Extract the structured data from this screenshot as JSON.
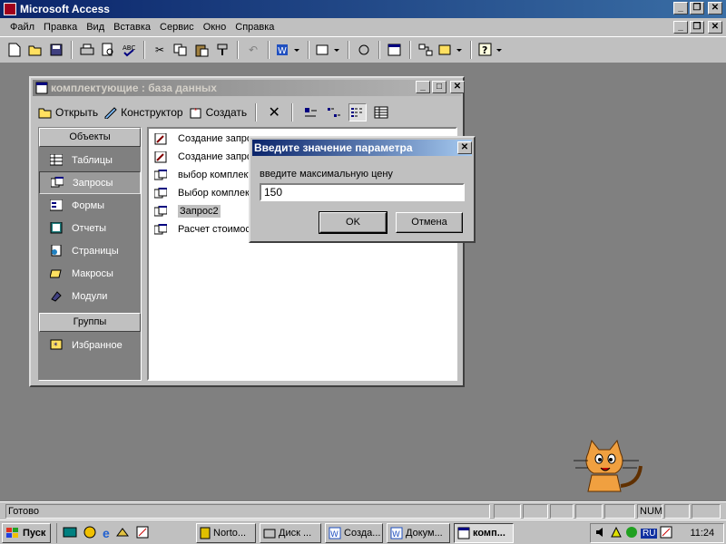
{
  "app": {
    "title": "Microsoft Access"
  },
  "menu": [
    "Файл",
    "Правка",
    "Вид",
    "Вставка",
    "Сервис",
    "Окно",
    "Справка"
  ],
  "db_window": {
    "title": "комплектующие : база данных",
    "tools": {
      "open": "Открыть",
      "design": "Конструктор",
      "create": "Создать"
    },
    "objects_header": "Объекты",
    "objects": [
      "Таблицы",
      "Запросы",
      "Формы",
      "Отчеты",
      "Страницы",
      "Макросы",
      "Модули"
    ],
    "groups_header": "Группы",
    "groups": [
      "Избранное"
    ],
    "list": [
      "Создание запроса в режиме конструктора",
      "Создание запроса с помощью мастера",
      "выбор комплектующих",
      "Выбор комплектующих",
      "Запрос2",
      "Расчет стоимости"
    ]
  },
  "dialog": {
    "title": "Введите значение параметра",
    "prompt": "введите максимальную цену",
    "value": "150",
    "ok": "OK",
    "cancel": "Отмена"
  },
  "status": {
    "text": "Готово",
    "num": "NUM"
  },
  "taskbar": {
    "start": "Пуск",
    "tasks": [
      "Norto...",
      "Диск ...",
      "Созда...",
      "Докум...",
      "комп..."
    ],
    "lang": "RU",
    "time": "11:24"
  }
}
